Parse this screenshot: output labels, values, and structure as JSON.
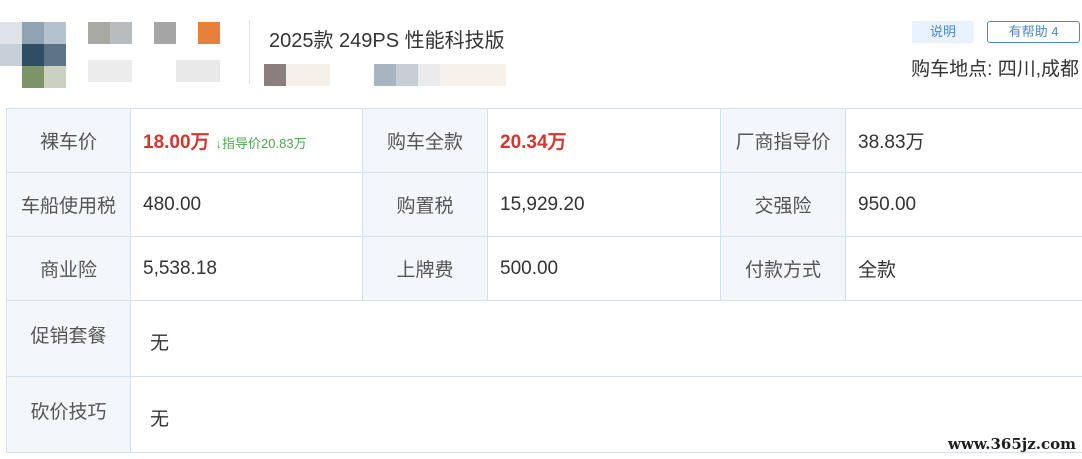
{
  "header": {
    "title": "2025款 249PS 性能科技版",
    "explain_label": "说明",
    "helpful_label": "有帮助 4",
    "location": "购车地点: 四川,成都"
  },
  "table": {
    "rows": [
      {
        "c1_label": "裸车价",
        "c1_value": "18.00万",
        "c1_note": "↓指导价20.83万",
        "c2_label": "购车全款",
        "c2_value": "20.34万",
        "c3_label": "厂商指导价",
        "c3_value": "38.83万"
      },
      {
        "c1_label": "车船使用税",
        "c1_value": "480.00",
        "c2_label": "购置税",
        "c2_value": "15,929.20",
        "c3_label": "交强险",
        "c3_value": "950.00"
      },
      {
        "c1_label": "商业险",
        "c1_value": "5,538.18",
        "c2_label": "上牌费",
        "c2_value": "500.00",
        "c3_label": "付款方式",
        "c3_value": "全款"
      }
    ],
    "promo_label": "促销套餐",
    "promo_value": "无",
    "bargain_label": "砍价技巧",
    "bargain_value": "无"
  },
  "watermark": "www.365jz.com",
  "colors": {
    "accent_red": "#d9342b",
    "note_green": "#4aa84e",
    "link_blue": "#4a88c8",
    "label_bg": "#f3f7fb",
    "border": "#d4e2ee"
  }
}
